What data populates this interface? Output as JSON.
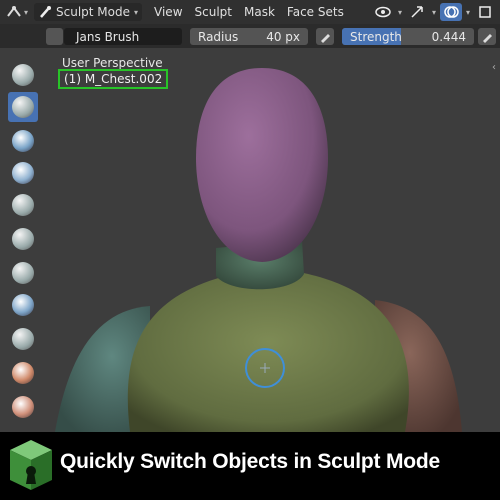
{
  "header": {
    "mode": "Sculpt Mode",
    "menus": [
      "View",
      "Sculpt",
      "Mask",
      "Face Sets"
    ]
  },
  "tool_settings": {
    "brush_name": "Jans Brush",
    "radius_label": "Radius",
    "radius_value": "40 px",
    "strength_label": "Strength",
    "strength_value": "0.444",
    "strength_fraction": 0.444
  },
  "viewport": {
    "perspective": "User Perspective",
    "active_object": "(1) M_Chest.002"
  },
  "tools": [
    "draw-brush",
    "draw-sharp-brush",
    "clay-brush",
    "clay-strips-brush",
    "clay-thumb-brush",
    "layer-brush",
    "inflate-brush",
    "blob-brush",
    "crease-brush",
    "smooth-brush",
    "flatten-brush",
    "fill-brush"
  ],
  "banner": {
    "title": "Quickly Switch Objects in Sculpt Mode"
  },
  "colors": {
    "accent": "#4772b3",
    "selection_outline": "#28c428",
    "head": "#8a5f8a",
    "neck": "#4c6b5a",
    "chest": "#6e7b4a",
    "left_arm": "#567a73",
    "right_arm": "#7a5a4f"
  }
}
